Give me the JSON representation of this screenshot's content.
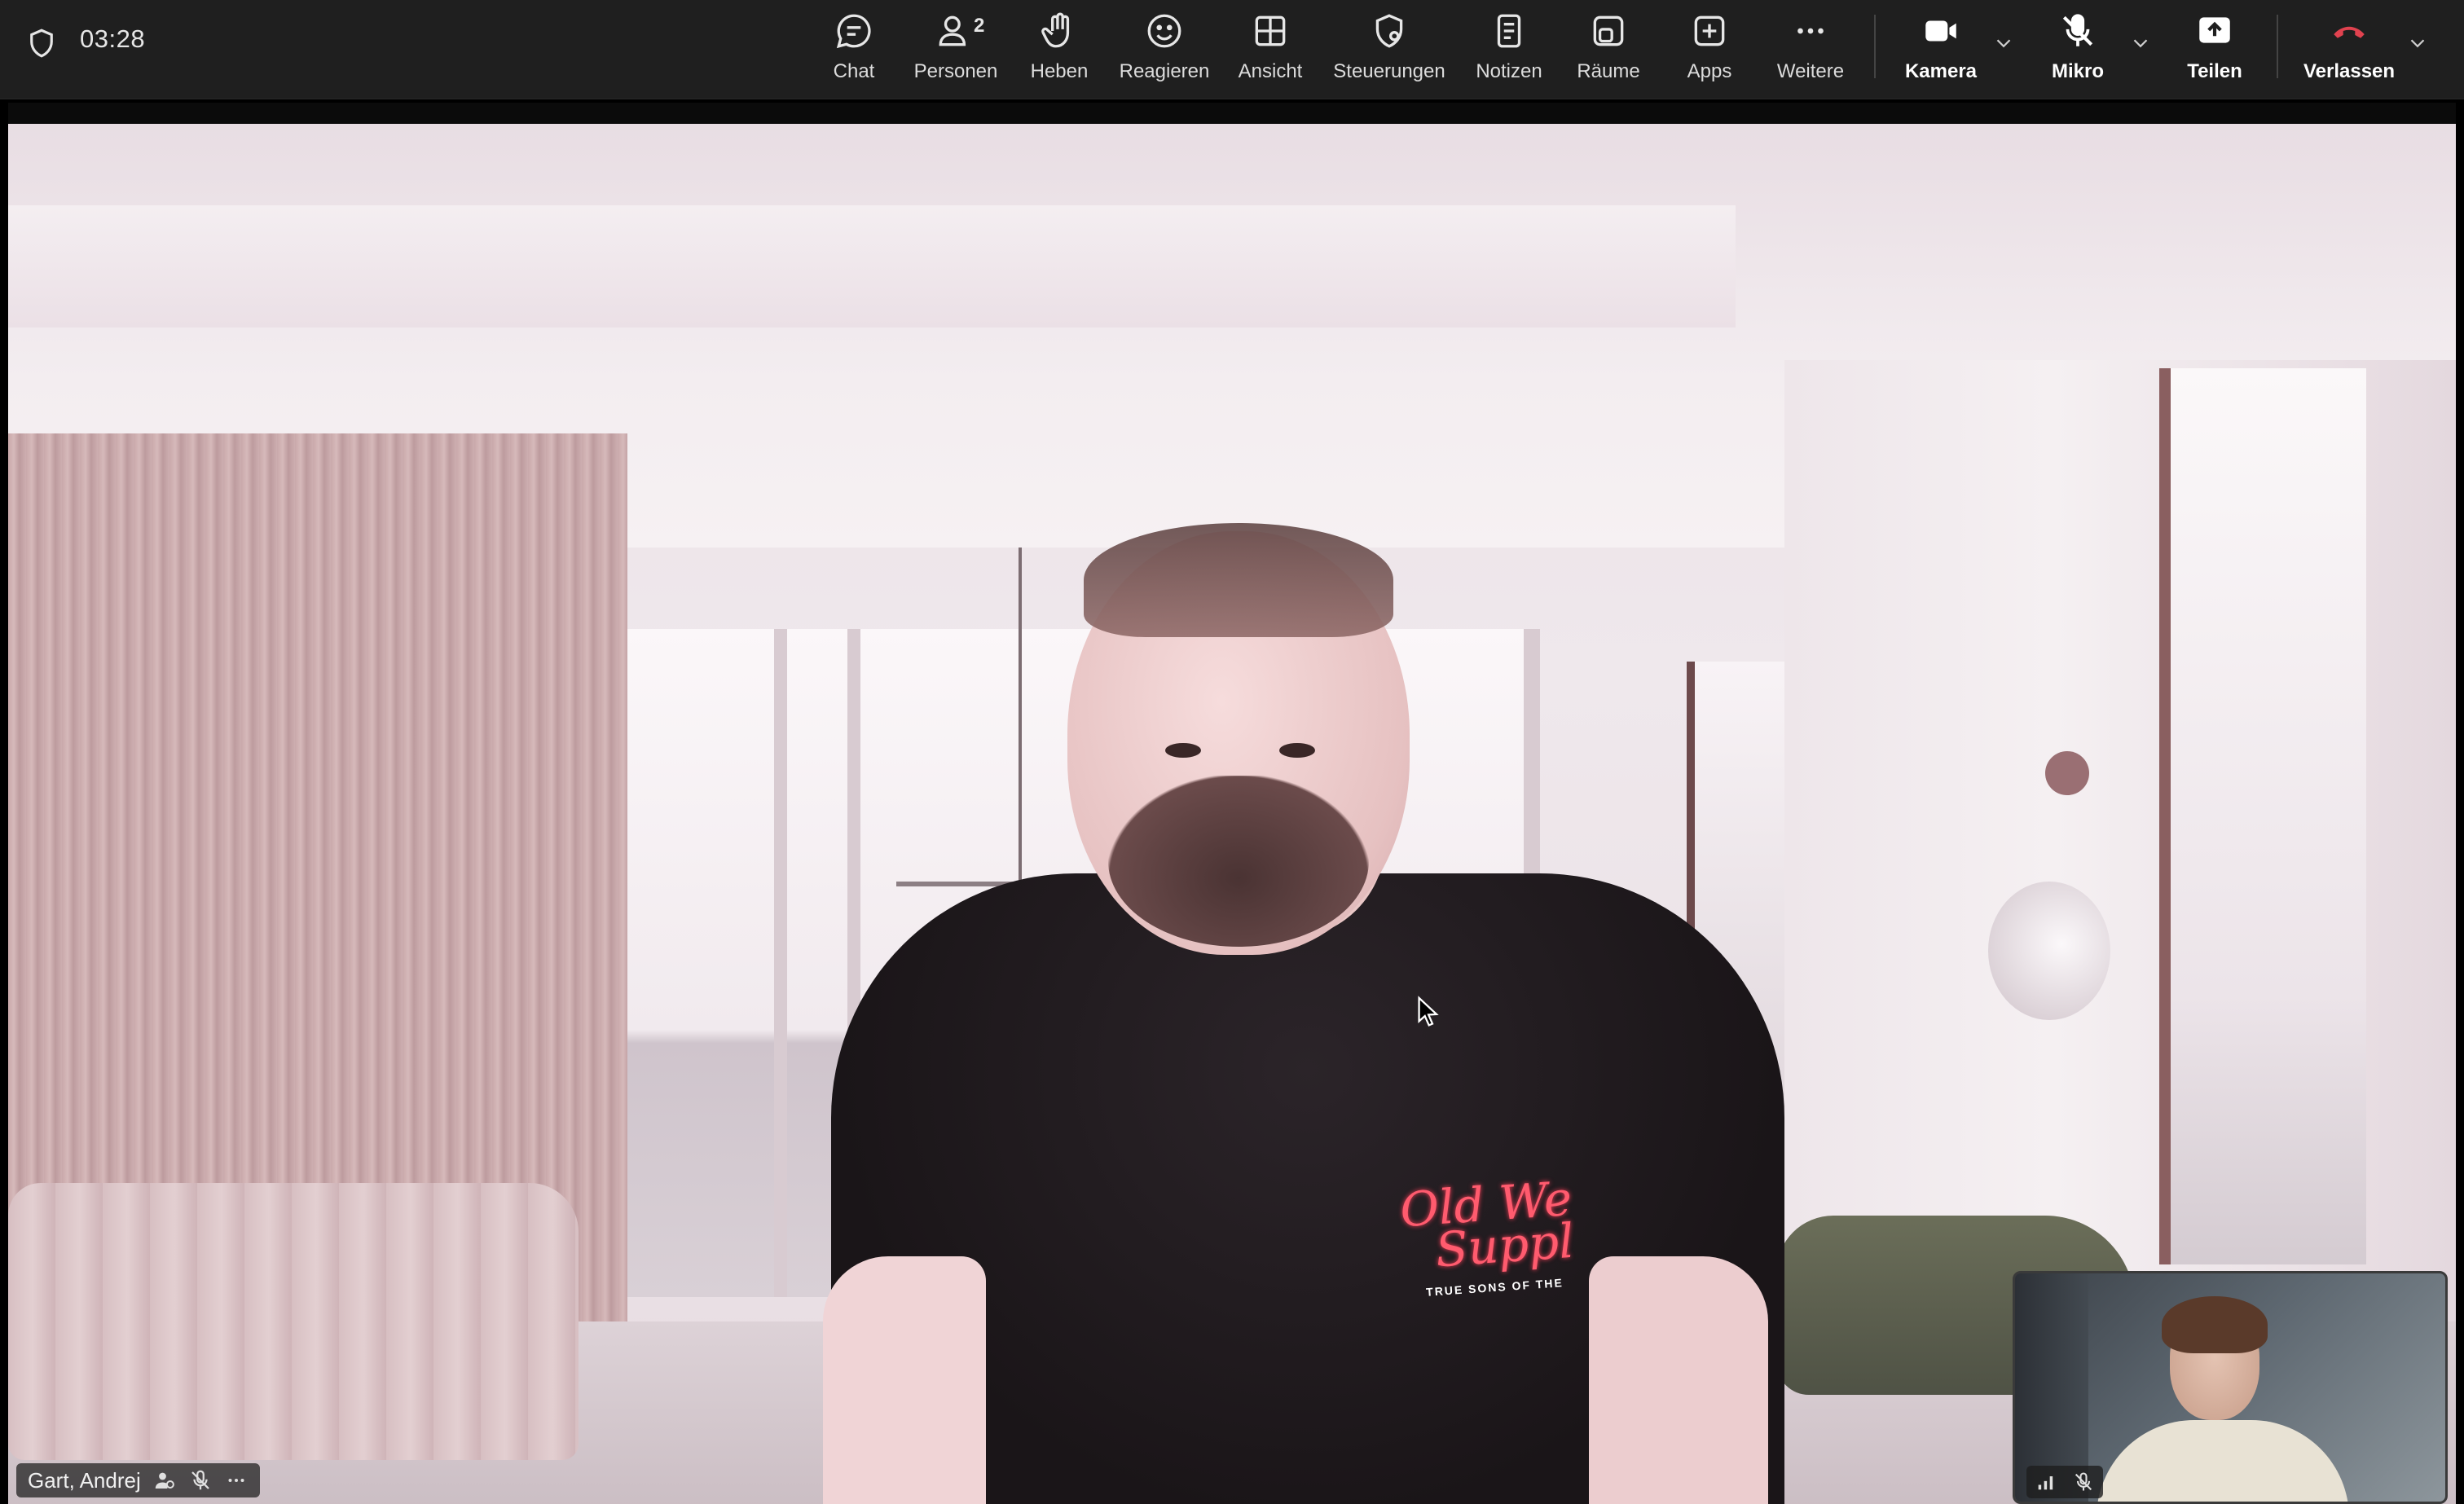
{
  "meeting": {
    "timer": "03:28"
  },
  "toolbar": {
    "chat": "Chat",
    "people": "Personen",
    "people_count": "2",
    "raise": "Heben",
    "react": "Reagieren",
    "view": "Ansicht",
    "controls": "Steuerungen",
    "notes": "Notizen",
    "rooms": "Räume",
    "apps": "Apps",
    "more": "Weitere",
    "camera": "Kamera",
    "mic": "Mikro",
    "share": "Teilen",
    "leave": "Verlassen"
  },
  "icons": {
    "shield": "shield-icon",
    "chat": "chat-icon",
    "people": "people-icon",
    "raise": "hand-icon",
    "react": "smiley-icon",
    "view": "grid-icon",
    "controls": "shield-gear-icon",
    "notes": "notes-icon",
    "rooms": "rooms-icon",
    "apps": "plus-square-icon",
    "more": "more-icon",
    "camera": "camera-icon",
    "mic": "mic-off-icon",
    "share": "share-icon",
    "leave": "phone-hangup-icon"
  },
  "main_participant": {
    "name": "Gart, Andrej",
    "shirt_text": [
      "Old We",
      "Suppl"
    ],
    "shirt_subtext": "TRUE SONS OF THE"
  },
  "colors": {
    "toolbar_bg": "#1f1f1f",
    "leave_red": "#e0424f",
    "text": "#dcdcdc"
  }
}
